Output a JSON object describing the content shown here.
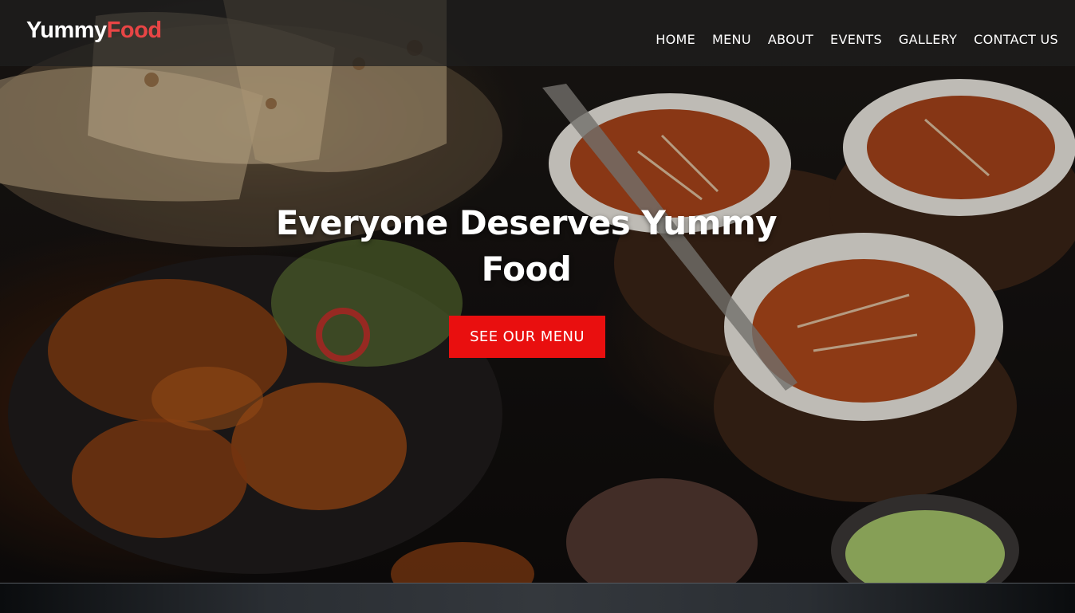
{
  "brand": {
    "name_part1": "Yummy",
    "name_part2": "Food",
    "accent": "#e84545"
  },
  "nav": {
    "items": [
      {
        "label": "HOME"
      },
      {
        "label": "MENU"
      },
      {
        "label": "ABOUT"
      },
      {
        "label": "EVENTS"
      },
      {
        "label": "GALLERY"
      },
      {
        "label": "CONTACT US"
      }
    ]
  },
  "hero": {
    "headline": "Everyone Deserves Yummy Food",
    "cta_label": "SEE OUR MENU",
    "cta_color": "#e90f0f",
    "background": "food-photo"
  }
}
